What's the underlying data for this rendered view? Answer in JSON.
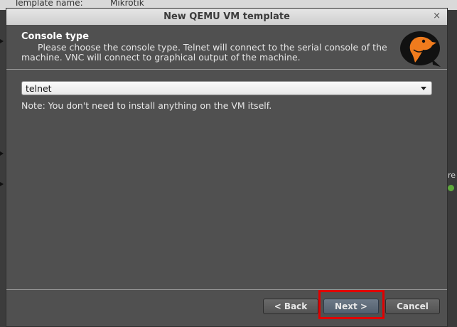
{
  "background": {
    "template_name_label": "Template name:",
    "template_name_value": "Mikrotik",
    "right_edge_text": "re"
  },
  "dialog": {
    "title": "New QEMU VM template",
    "close_glyph": "×",
    "header": {
      "title": "Console type",
      "description": "Please choose the console type. Telnet will connect to the serial console of the machine. VNC will connect to graphical output of the machine."
    },
    "console_select": {
      "value": "telnet"
    },
    "note": "Note: You don't need to install anything on the VM itself.",
    "buttons": {
      "back": "< Back",
      "next": "Next >",
      "cancel": "Cancel"
    }
  },
  "colors": {
    "dialog_bg": "#505050",
    "highlight": "#e00000",
    "logo_orange": "#f07b1d"
  }
}
